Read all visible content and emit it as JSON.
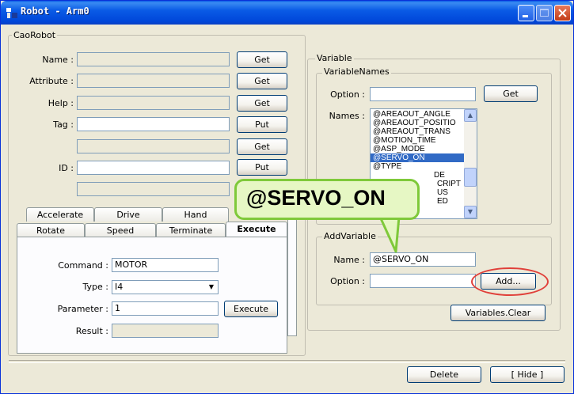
{
  "window": {
    "title": "Robot - Arm0"
  },
  "cao_robot": {
    "legend": "CaoRobot",
    "fields": [
      {
        "label": "Name :",
        "button": "Get"
      },
      {
        "label": "Attribute :",
        "button": "Get"
      },
      {
        "label": "Help :",
        "button": "Get"
      },
      {
        "label": "Tag :",
        "button": "Put"
      },
      {
        "label": "",
        "button": "Get"
      },
      {
        "label": "ID :",
        "button": "Put"
      }
    ],
    "tabs_row1": [
      "Accelerate",
      "Drive",
      "Hand"
    ],
    "tabs_row2": [
      "Rotate",
      "Speed",
      "Terminate",
      "Execute"
    ],
    "execute": {
      "command_label": "Command :",
      "command_value": "MOTOR",
      "type_label": "Type :",
      "type_value": "I4",
      "parameter_label": "Parameter :",
      "parameter_value": "1",
      "execute_button": "Execute",
      "result_label": "Result :"
    }
  },
  "variable": {
    "legend": "Variable",
    "names_group": {
      "legend": "VariableNames",
      "option_label": "Option :",
      "get_button": "Get",
      "names_label": "Names :",
      "items": [
        "@AREAOUT_ANGLE",
        "@AREAOUT_POSITIO",
        "@AREAOUT_TRANS",
        "@MOTION_TIME",
        "@ASP_MODE",
        "@SERVO_ON",
        "@TYPE",
        "DE",
        "CRIPT",
        "US",
        "ED"
      ],
      "selected_index": 5
    },
    "add_group": {
      "legend": "AddVariable",
      "name_label": "Name :",
      "name_value": "@SERVO_ON",
      "option_label": "Option :",
      "add_button": "Add..."
    },
    "clear_button": "Variables.Clear"
  },
  "footer": {
    "delete_button": "Delete",
    "hide_button": "[ Hide ]"
  },
  "callout": {
    "text": "@SERVO_ON"
  },
  "colors": {
    "selection": "#316ac5",
    "callout_fill": "#e6f7c4",
    "callout_border": "#7fc93a",
    "highlight_ring": "#e0403a"
  }
}
